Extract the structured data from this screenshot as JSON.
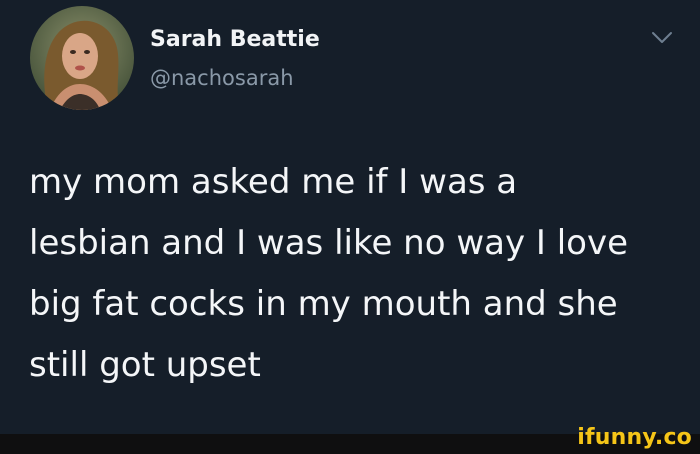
{
  "tweet": {
    "author": {
      "display_name": "Sarah Beattie",
      "handle": "@nachosarah",
      "avatar_icon": "profile-photo"
    },
    "menu_icon": "chevron-down-icon",
    "text_lines": [
      "my mom asked me if I was a",
      "lesbian and I was like no way I love",
      "big fat cocks in my mouth and she",
      "still got upset"
    ]
  },
  "watermark": {
    "text": "ifunny.co",
    "color": "#f5c518"
  },
  "colors": {
    "background": "#151e29",
    "primary_text": "#f4f6f8",
    "secondary_text": "#8a99a8"
  }
}
